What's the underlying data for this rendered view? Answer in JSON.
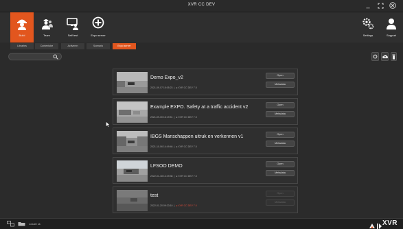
{
  "window": {
    "title": "XVR CC DEV"
  },
  "toolbar": {
    "items": [
      {
        "label": "Build",
        "icon": "firefighter-icon",
        "active": true
      },
      {
        "label": "Team",
        "icon": "team-icon",
        "active": false
      },
      {
        "label": "Self test",
        "icon": "self-test-icon",
        "active": false
      },
      {
        "label": "Expo server",
        "icon": "expo-server-icon",
        "active": false
      }
    ],
    "right_items": [
      {
        "label": "Settings",
        "icon": "gears-icon"
      },
      {
        "label": "Support",
        "icon": "support-icon"
      }
    ]
  },
  "tabs": {
    "items": [
      {
        "label": "Libraries",
        "active": false
      },
      {
        "label": "Contentobe",
        "active": false
      },
      {
        "label": "Activeren",
        "active": false
      },
      {
        "label": "Scenario",
        "active": false
      },
      {
        "label": "Expo server",
        "active": true
      }
    ]
  },
  "search": {
    "value": ""
  },
  "cards": [
    {
      "name": "Demo Expo_v2",
      "date": "2021-09-07 15:05:23",
      "version": "XVR CC DEV 7.5",
      "warn": false,
      "open": "Open",
      "metadata": "Metadata"
    },
    {
      "name": "Example EXPO. Safety at a traffic accident v2",
      "date": "2021-09-30 16:19:51",
      "version": "XVR CC DEV 7.5",
      "warn": false,
      "open": "Open",
      "metadata": "Metadata"
    },
    {
      "name": "IBGS Manschappen uitruk en verkennen v1",
      "date": "2021-10-06 14:49:46",
      "version": "XVR CC DEV 7.5",
      "warn": false,
      "open": "Open",
      "metadata": "Metadata"
    },
    {
      "name": "LFSOO DEMO",
      "date": "2022-01-18 14:49:38",
      "version": "XVR CC DEV 7.5",
      "warn": false,
      "open": "Open",
      "metadata": "Metadata"
    },
    {
      "name": "test",
      "date": "2022-01-20 09:23:10",
      "version": "XVR CC DEV 7.0",
      "warn": true,
      "open": "Open",
      "metadata": "Metadata"
    }
  ],
  "statusbar": {
    "text": "Lokale sk",
    "brand": "XVR"
  },
  "colors": {
    "accent": "#e2561e",
    "warning": "#e04a3a"
  }
}
